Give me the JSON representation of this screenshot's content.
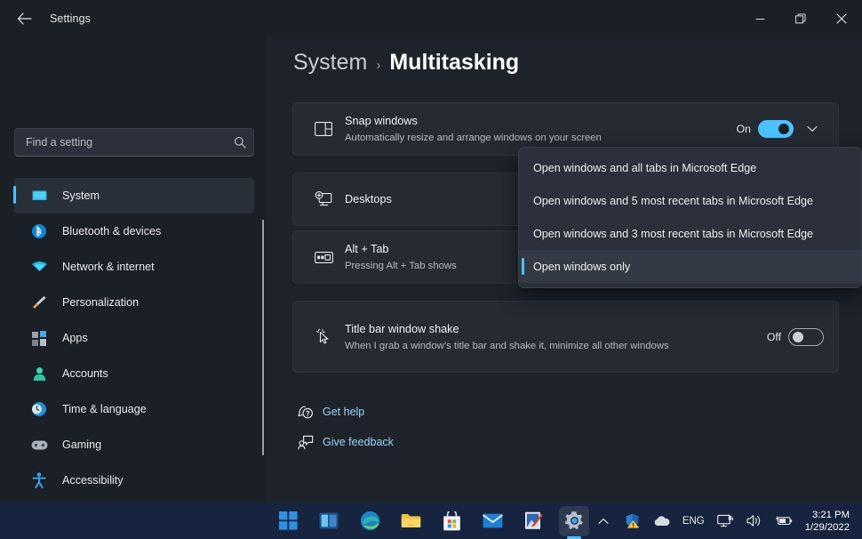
{
  "window": {
    "title": "Settings",
    "back_icon": "back-arrow-icon",
    "minimize_label": "Minimize",
    "restore_label": "Restore",
    "close_label": "Close"
  },
  "search": {
    "placeholder": "Find a setting",
    "value": "",
    "icon": "search-icon"
  },
  "sidebar": {
    "items": [
      {
        "label": "System",
        "icon": "monitor-icon",
        "active": true
      },
      {
        "label": "Bluetooth & devices",
        "icon": "bluetooth-icon",
        "active": false
      },
      {
        "label": "Network & internet",
        "icon": "wifi-icon",
        "active": false
      },
      {
        "label": "Personalization",
        "icon": "paintbrush-icon",
        "active": false
      },
      {
        "label": "Apps",
        "icon": "apps-grid-icon",
        "active": false
      },
      {
        "label": "Accounts",
        "icon": "person-icon",
        "active": false
      },
      {
        "label": "Time & language",
        "icon": "clock-globe-icon",
        "active": false
      },
      {
        "label": "Gaming",
        "icon": "gamepad-icon",
        "active": false
      },
      {
        "label": "Accessibility",
        "icon": "accessibility-icon",
        "active": false
      }
    ]
  },
  "breadcrumb": {
    "root": "System",
    "separator": "›",
    "current": "Multitasking"
  },
  "settings": {
    "snap_windows": {
      "title": "Snap windows",
      "subtitle": "Automatically resize and arrange windows on your screen",
      "icon": "snap-layout-icon",
      "state_label": "On",
      "toggle": "on",
      "expand_icon": "chevron-down-icon"
    },
    "desktops": {
      "title": "Desktops",
      "icon": "desktop-add-icon",
      "expand_icon": "chevron-down-icon"
    },
    "alt_tab": {
      "title": "Alt + Tab",
      "subtitle": "Pressing Alt + Tab shows",
      "icon": "keyboard-icon"
    },
    "title_bar_shake": {
      "title": "Title bar window shake",
      "subtitle": "When I grab a window’s title bar and shake it, minimize all other windows",
      "icon": "cursor-click-icon",
      "state_label": "Off",
      "toggle": "off"
    }
  },
  "dropdown": {
    "open": true,
    "options": [
      {
        "label": "Open windows and all tabs in Microsoft Edge",
        "selected": false
      },
      {
        "label": "Open windows and 5 most recent tabs in Microsoft Edge",
        "selected": false
      },
      {
        "label": "Open windows and 3 most recent tabs in Microsoft Edge",
        "selected": false
      },
      {
        "label": "Open windows only",
        "selected": true
      }
    ]
  },
  "links": [
    {
      "label": "Get help",
      "icon": "help-question-icon"
    },
    {
      "label": "Give feedback",
      "icon": "feedback-icon"
    }
  ],
  "taskbar": {
    "apps": [
      {
        "name": "start-button",
        "icon": "windows-logo-icon",
        "active": false
      },
      {
        "name": "task-view-button",
        "icon": "task-view-icon",
        "active": false
      },
      {
        "name": "edge-button",
        "icon": "edge-icon",
        "active": false
      },
      {
        "name": "file-explorer-button",
        "icon": "folder-icon",
        "active": false
      },
      {
        "name": "microsoft-store-button",
        "icon": "store-bag-icon",
        "active": false
      },
      {
        "name": "mail-button",
        "icon": "mail-envelope-icon",
        "active": false
      },
      {
        "name": "paint-button",
        "icon": "paint-picture-icon",
        "active": false
      },
      {
        "name": "settings-button",
        "icon": "gear-icon",
        "active": true
      }
    ],
    "tray": {
      "overflow_icon": "chevron-up-icon",
      "defender_icon": "shield-warning-icon",
      "onedrive_icon": "cloud-icon",
      "language": "ENG",
      "network_icon": "network-icon",
      "volume_icon": "speaker-icon",
      "battery_icon": "battery-charging-icon",
      "time": "3:21 PM",
      "date": "1/29/2022"
    }
  },
  "colors": {
    "accent": "#4cc2ff",
    "page_bg": "#1e222a",
    "sidebar_bg": "#1b1f26",
    "card_bg": "#252a33",
    "flyout_bg": "#2b303a",
    "taskbar_bg": "#17243f",
    "link": "#9bd4f5"
  }
}
